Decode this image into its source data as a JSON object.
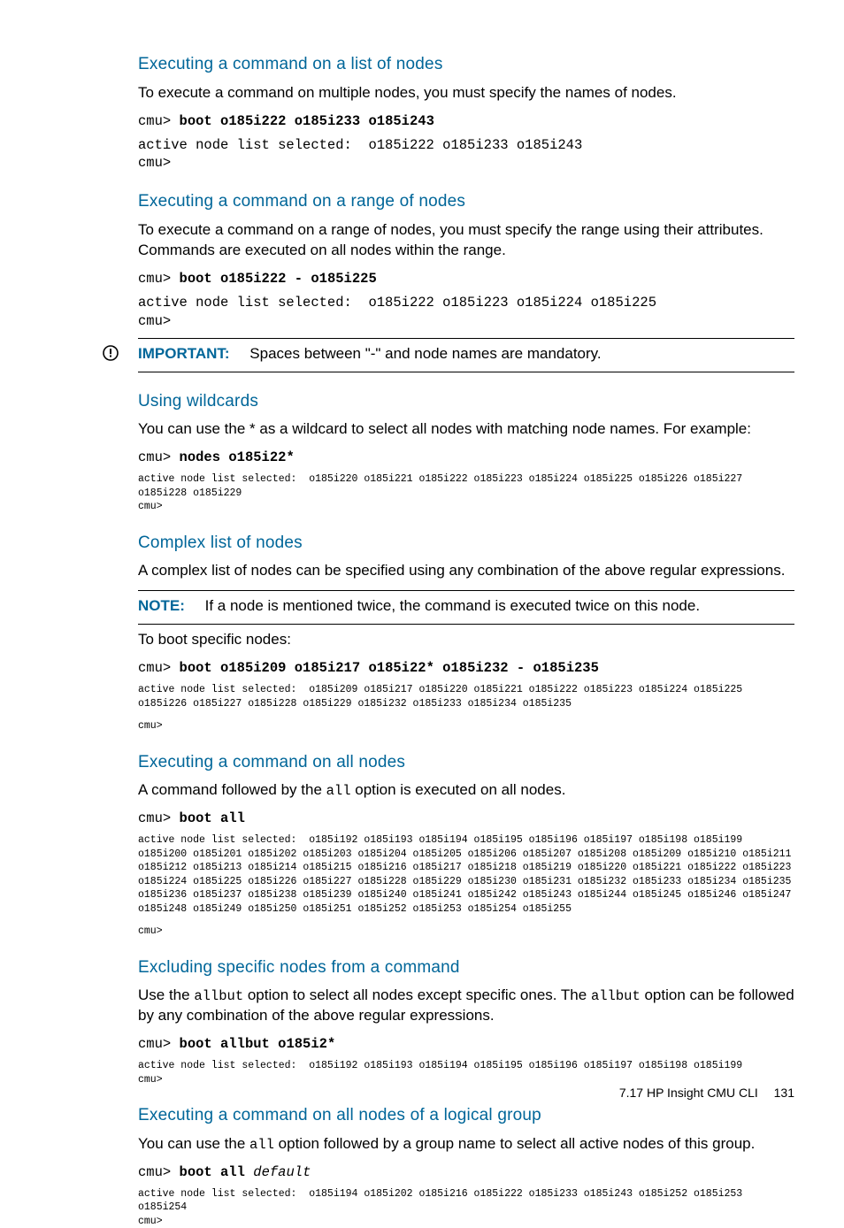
{
  "sections": {
    "s1": {
      "heading": "Executing a command on a list of nodes",
      "para": "To execute a command on multiple nodes, you must specify the names of nodes.",
      "prompt": "cmu>",
      "cmd": "boot o185i222 o185i233 o185i243",
      "output": "active node list selected:  o185i222 o185i233 o185i243\ncmu>"
    },
    "s2": {
      "heading": "Executing a command on a range of nodes",
      "para": "To execute a command on a range of nodes, you must specify the range using their attributes. Commands are executed on all nodes within the range.",
      "prompt": "cmu>",
      "cmd": "boot o185i222 - o185i225",
      "output": "active node list selected:  o185i222 o185i223 o185i224 o185i225\ncmu>"
    },
    "important": {
      "label": "IMPORTANT:",
      "text": "Spaces between \"-\" and node names are mandatory."
    },
    "s3": {
      "heading": "Using wildcards",
      "para": "You can use the * as a wildcard to select all nodes with matching node names. For example:",
      "prompt": "cmu>",
      "cmd": "nodes o185i22*",
      "output": "active node list selected:  o185i220 o185i221 o185i222 o185i223 o185i224 o185i225 o185i226 o185i227 o185i228 o185i229\ncmu>"
    },
    "s4": {
      "heading": "Complex list of nodes",
      "para": "A complex list of nodes can be specified using any combination of the above regular expressions.",
      "note_label": "NOTE:",
      "note_text": "If a node is mentioned twice, the command is executed twice on this node.",
      "para2": "To boot specific nodes:",
      "prompt": "cmu>",
      "cmd": "boot o185i209 o185i217 o185i22* o185i232 - o185i235",
      "output": "active node list selected:  o185i209 o185i217 o185i220 o185i221 o185i222 o185i223 o185i224 o185i225 o185i226 o185i227 o185i228 o185i229 o185i232 o185i233 o185i234 o185i235",
      "endprompt": "cmu>"
    },
    "s5": {
      "heading": "Executing a command on all nodes",
      "para_pre": "A command followed by the ",
      "para_code": "all",
      "para_post": " option is executed on all nodes.",
      "prompt": "cmu>",
      "cmd": "boot all",
      "output": "active node list selected:  o185i192 o185i193 o185i194 o185i195 o185i196 o185i197 o185i198 o185i199 o185i200 o185i201 o185i202 o185i203 o185i204 o185i205 o185i206 o185i207 o185i208 o185i209 o185i210 o185i211 o185i212 o185i213 o185i214 o185i215 o185i216 o185i217 o185i218 o185i219 o185i220 o185i221 o185i222 o185i223 o185i224 o185i225 o185i226 o185i227 o185i228 o185i229 o185i230 o185i231 o185i232 o185i233 o185i234 o185i235 o185i236 o185i237 o185i238 o185i239 o185i240 o185i241 o185i242 o185i243 o185i244 o185i245 o185i246 o185i247 o185i248 o185i249 o185i250 o185i251 o185i252 o185i253 o185i254 o185i255",
      "endprompt": "cmu>"
    },
    "s6": {
      "heading": "Excluding specific nodes from a command",
      "para_pre": "Use the ",
      "para_code1": "allbut",
      "para_mid": " option to select all nodes except specific ones. The ",
      "para_code2": "allbut",
      "para_post": " option can be followed by any combination of the above regular expressions.",
      "prompt": "cmu>",
      "cmd": "boot allbut o185i2*",
      "output": "active node list selected:  o185i192 o185i193 o185i194 o185i195 o185i196 o185i197 o185i198 o185i199\ncmu>"
    },
    "s7": {
      "heading": "Executing a command on all nodes of a logical group",
      "para_pre": "You can use the ",
      "para_code": "all",
      "para_post": " option followed by a group name to select all active nodes of this group.",
      "prompt": "cmu>",
      "cmd": "boot all",
      "arg_italic": "default",
      "output": "active node list selected:  o185i194 o185i202 o185i216 o185i222 o185i233 o185i243 o185i252 o185i253 o185i254\ncmu>"
    }
  },
  "footer": {
    "section": "7.17 HP Insight CMU CLI",
    "page": "131"
  }
}
